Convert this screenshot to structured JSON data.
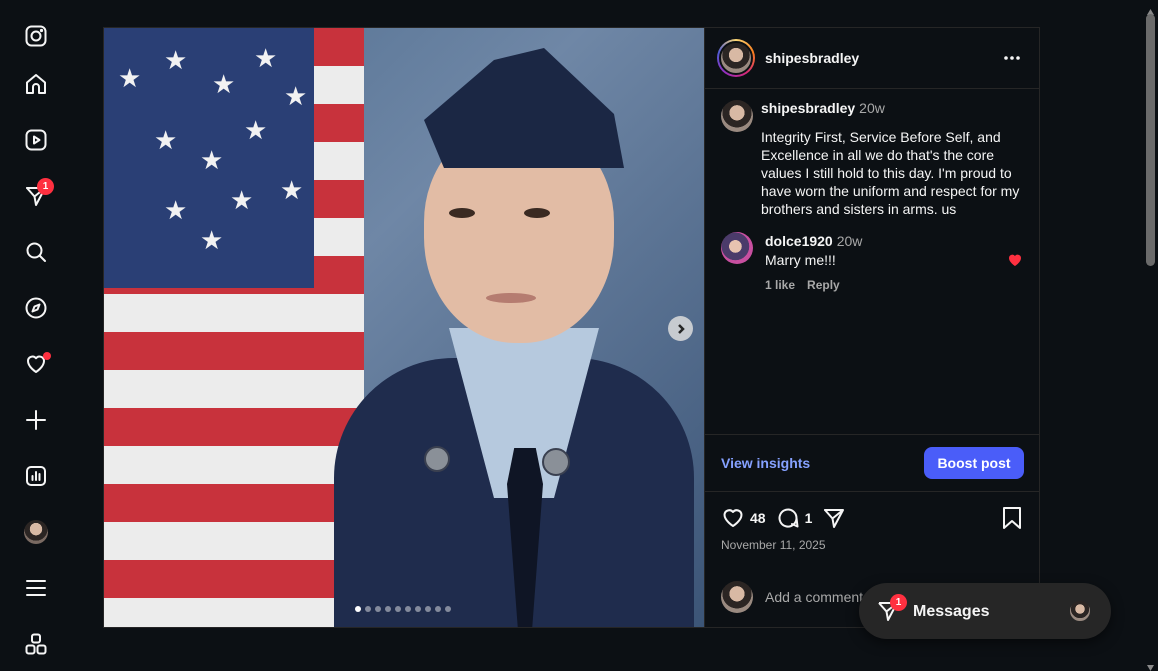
{
  "nav": {
    "items": [
      {
        "name": "instagram-logo-icon"
      },
      {
        "name": "home-icon",
        "label": "Home"
      },
      {
        "name": "reels-icon",
        "label": "Reels"
      },
      {
        "name": "messages-icon",
        "label": "Messages",
        "badge": "1"
      },
      {
        "name": "search-icon",
        "label": "Search"
      },
      {
        "name": "explore-icon",
        "label": "Explore"
      },
      {
        "name": "notifications-icon",
        "label": "Notifications"
      },
      {
        "name": "create-icon",
        "label": "Create"
      },
      {
        "name": "dashboard-icon",
        "label": "Dashboard"
      },
      {
        "name": "profile-avatar",
        "label": "Profile"
      },
      {
        "name": "menu-icon",
        "label": "More"
      },
      {
        "name": "also-from-meta-icon",
        "label": "Also from Meta"
      }
    ],
    "messages_badge": "1"
  },
  "post": {
    "carousel": {
      "total_slides": 10,
      "active_slide": 1
    },
    "header": {
      "username": "shipesbradley"
    },
    "caption": {
      "username": "shipesbradley",
      "time": "20w",
      "text": "Integrity First, Service Before Self, and Excellence in all we do that's the core values I still hold to this day. I'm proud to have worn the uniform and respect for my brothers and sisters in arms. us"
    },
    "comments": [
      {
        "username": "dolce1920",
        "time": "20w",
        "text": "Marry me!!!",
        "likes": "1 like",
        "reply_label": "Reply",
        "liked": true
      }
    ],
    "view_insights_label": "View insights",
    "boost_label": "Boost post",
    "likes_count": "48",
    "comments_count": "1",
    "date": "November 11, 2025",
    "add_comment_placeholder": "Add a comment..."
  },
  "messages_widget": {
    "label": "Messages",
    "badge": "1"
  },
  "colors": {
    "accent": "#4a5df9",
    "link": "#85a1ff",
    "badge": "#ff3040",
    "background": "#0c1014"
  }
}
